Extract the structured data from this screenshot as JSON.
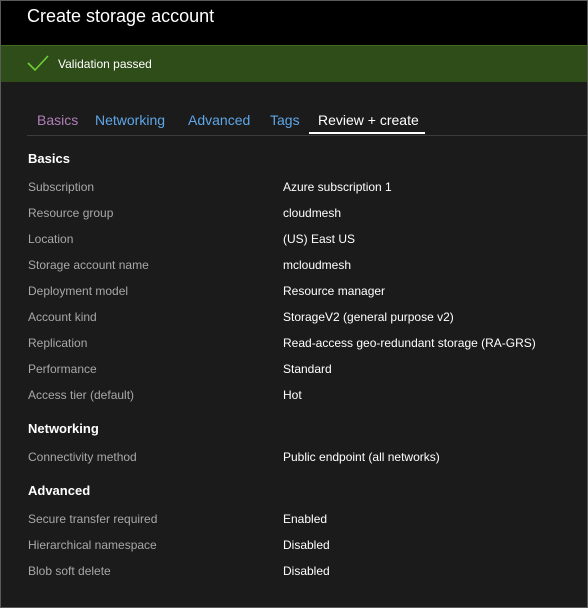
{
  "window": {
    "title": "Create storage account"
  },
  "banner": {
    "text": "Validation passed",
    "icon": "checkmark-icon",
    "background": "#2f4d19",
    "check_color": "#6fcf3a"
  },
  "tabs": [
    {
      "label": "Basics",
      "color": "#b07fb8",
      "active": false
    },
    {
      "label": "Networking",
      "color": "#5ea6e8",
      "active": false
    },
    {
      "label": "Advanced",
      "color": "#5ea6e8",
      "active": false
    },
    {
      "label": "Tags",
      "color": "#5ea6e8",
      "active": false
    },
    {
      "label": "Review + create",
      "color": "#ffffff",
      "active": true
    }
  ],
  "sections": {
    "basics": {
      "heading": "Basics",
      "rows": [
        {
          "label": "Subscription",
          "value": "Azure subscription 1"
        },
        {
          "label": "Resource group",
          "value": "cloudmesh"
        },
        {
          "label": "Location",
          "value": "(US) East US"
        },
        {
          "label": "Storage account name",
          "value": "mcloudmesh"
        },
        {
          "label": "Deployment model",
          "value": "Resource manager"
        },
        {
          "label": "Account kind",
          "value": "StorageV2 (general purpose v2)"
        },
        {
          "label": "Replication",
          "value": "Read-access geo-redundant storage (RA-GRS)"
        },
        {
          "label": "Performance",
          "value": "Standard"
        },
        {
          "label": "Access tier (default)",
          "value": "Hot"
        }
      ]
    },
    "networking": {
      "heading": "Networking",
      "rows": [
        {
          "label": "Connectivity method",
          "value": "Public endpoint (all networks)"
        }
      ]
    },
    "advanced": {
      "heading": "Advanced",
      "rows": [
        {
          "label": "Secure transfer required",
          "value": "Enabled"
        },
        {
          "label": "Hierarchical namespace",
          "value": "Disabled"
        },
        {
          "label": "Blob soft delete",
          "value": "Disabled"
        }
      ]
    }
  }
}
